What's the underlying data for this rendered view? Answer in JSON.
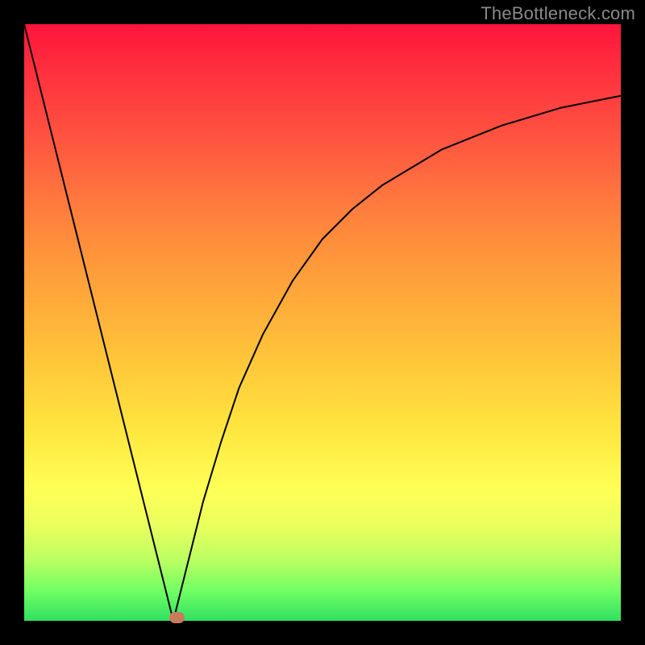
{
  "attribution": "TheBottleneck.com",
  "colors": {
    "background": "#000000",
    "curve": "#000000",
    "marker": "#cc7a5e",
    "gradient_stops": [
      {
        "pos": 0,
        "hex": "#ff143c"
      },
      {
        "pos": 0.2,
        "hex": "#ff5a40"
      },
      {
        "pos": 0.45,
        "hex": "#ffb039"
      },
      {
        "pos": 0.7,
        "hex": "#fff249"
      },
      {
        "pos": 0.9,
        "hex": "#b0ff5e"
      },
      {
        "pos": 1.0,
        "hex": "#30e060"
      }
    ]
  },
  "chart_data": {
    "type": "line",
    "title": "",
    "xlabel": "",
    "ylabel": "",
    "xlim": [
      0,
      100
    ],
    "ylim": [
      0,
      100
    ],
    "series": [
      {
        "name": "curve",
        "x": [
          0,
          5,
          10,
          15,
          20,
          22,
          24,
          25,
          26,
          28,
          30,
          33,
          36,
          40,
          45,
          50,
          55,
          60,
          65,
          70,
          75,
          80,
          85,
          90,
          95,
          100
        ],
        "y": [
          100,
          80,
          60,
          40,
          20,
          12,
          4,
          0,
          4,
          12,
          20,
          30,
          39,
          48,
          57,
          64,
          69,
          73,
          76,
          79,
          81,
          83,
          84.5,
          86,
          87,
          88
        ]
      }
    ],
    "marker": {
      "x": 25.5,
      "y": 0.6
    }
  }
}
